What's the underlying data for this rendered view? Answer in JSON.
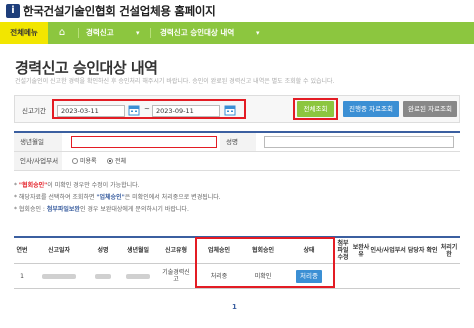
{
  "header": {
    "logo_glyph": "i",
    "title": "한국건설기술인협회 건설업체용 홈페이지"
  },
  "nav": {
    "menu_label": "전체메뉴",
    "home_icon": "home-icon",
    "crumb1": "경력신고",
    "crumb2": "경력신고 승인대상 내역"
  },
  "page": {
    "title": "경력신고 승인대상 내역",
    "subtitle": "건설기술인이 신고한 경력을 확인하신 후 승인처리 해주시기 바랍니다. 승인이 완료된 경력신고 내역은 별도 조회할 수 있습니다."
  },
  "search": {
    "period_label": "신고기간",
    "date_from": "2023-03-11",
    "date_to": "2023-09-11",
    "tilde": "~",
    "btn_search": "전체조회",
    "btn_in_progress": "진행중 자료조회",
    "btn_done": "완료된 자료조회"
  },
  "filters": {
    "birth_label": "생년월일",
    "name_label": "성명",
    "approval_label": "인사/사업부서",
    "radio_unconfirmed": "미용록",
    "radio_all": "전체"
  },
  "notes": [
    {
      "pre": "* ",
      "hl": "\"협회승인\"",
      "post": "이 미확인 경우만 수정이 가능합니다."
    },
    {
      "pre": "* 해당자료를 선택하여 조회하면 ",
      "hl": "\"업체승인\"",
      "post": "은 미확인에서 처리중으로 변경됩니다."
    },
    {
      "pre": "* 협회승인 : ",
      "hl": "첨부파일보완",
      "post": "인 경우 보완대상에게 문의하시기 바랍니다."
    }
  ],
  "grid": {
    "headers": {
      "no": "연번",
      "date": "신고일자",
      "name": "성명",
      "birth": "생년월일",
      "type": "신고유형",
      "company_approval": "업체승인",
      "assoc_approval": "협회승인",
      "status": "상태",
      "attach": "첨부파일수정",
      "supplement": "보완사유",
      "dept_confirm": "인사/사업부서 담당자 확인",
      "deadline": "처리기한"
    },
    "rows": [
      {
        "no": "1",
        "type": "기술경력신고",
        "company_approval": "처리중",
        "assoc_approval": "미확인",
        "status_btn": "처리중"
      }
    ]
  },
  "pager": {
    "current": "1"
  },
  "colors": {
    "nav_green": "#8cc63f",
    "menu_yellow": "#f2e600",
    "highlight_red": "#e31c24",
    "primary_blue": "#3b8fd4",
    "navy": "#1e3e7b"
  }
}
